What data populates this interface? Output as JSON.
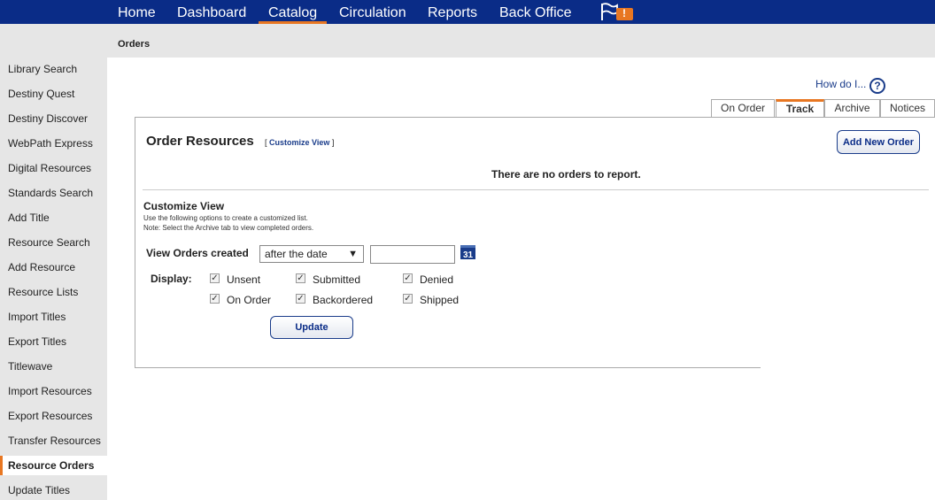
{
  "nav": {
    "items": [
      {
        "label": "Home"
      },
      {
        "label": "Dashboard"
      },
      {
        "label": "Catalog"
      },
      {
        "label": "Circulation"
      },
      {
        "label": "Reports"
      },
      {
        "label": "Back Office"
      }
    ],
    "active": "Catalog",
    "alert_badge": "!"
  },
  "breadcrumb": "Orders",
  "sidebar": {
    "items": [
      {
        "label": "Library Search"
      },
      {
        "label": "Destiny Quest"
      },
      {
        "label": "Destiny Discover"
      },
      {
        "label": "WebPath Express"
      },
      {
        "label": "Digital Resources"
      },
      {
        "label": "Standards Search"
      },
      {
        "label": "Add Title"
      },
      {
        "label": "Resource Search"
      },
      {
        "label": "Add Resource"
      },
      {
        "label": "Resource Lists"
      },
      {
        "label": "Import Titles"
      },
      {
        "label": "Export Titles"
      },
      {
        "label": "Titlewave"
      },
      {
        "label": "Import Resources"
      },
      {
        "label": "Export Resources"
      },
      {
        "label": "Transfer Resources"
      },
      {
        "label": "Resource Orders"
      },
      {
        "label": "Update Titles"
      }
    ],
    "active": "Resource Orders"
  },
  "help": {
    "label": "How do I...",
    "icon": "?"
  },
  "tabs": [
    {
      "label": "On Order"
    },
    {
      "label": "Track"
    },
    {
      "label": "Archive"
    },
    {
      "label": "Notices"
    }
  ],
  "active_tab": "Track",
  "panel": {
    "title": "Order Resources",
    "customize_open": "[",
    "customize_link": "Customize View",
    "customize_close": "]",
    "add_button": "Add New Order",
    "empty_message": "There are no orders to report."
  },
  "customize": {
    "heading": "Customize View",
    "note1": "Use the following options to create a customized list.",
    "note2": "Note: Select the Archive tab to view completed orders.",
    "view_label": "View Orders created",
    "date_mode": "after the date",
    "date_value": "",
    "calendar_icon": "31",
    "display_label": "Display:",
    "statuses": [
      {
        "label": "Unsent",
        "checked": true
      },
      {
        "label": "Submitted",
        "checked": true
      },
      {
        "label": "Denied",
        "checked": true
      },
      {
        "label": "On Order",
        "checked": true
      },
      {
        "label": "Backordered",
        "checked": true
      },
      {
        "label": "Shipped",
        "checked": true
      }
    ],
    "update_button": "Update"
  },
  "colors": {
    "nav_bg": "#0a2c87",
    "accent": "#e87722",
    "link": "#1a3c8a",
    "sidebar_bg": "#e6e6e6"
  }
}
